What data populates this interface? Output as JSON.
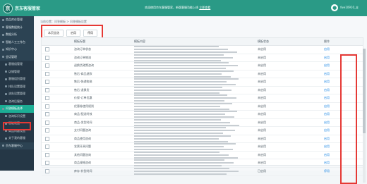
{
  "app": {
    "title": "京东客服管家",
    "notice": "欢迎使用京东客服管家，新版客服功能上线",
    "notice_link": "立即查看",
    "user": "fwe10910_支"
  },
  "sidebar": {
    "items": [
      {
        "label": "商品库存管理",
        "type": "group"
      },
      {
        "label": "客服数据统计",
        "type": "group"
      },
      {
        "label": "数据分析",
        "type": "group"
      },
      {
        "label": "智能人工工作台",
        "type": "group"
      },
      {
        "label": "知识中心",
        "type": "group"
      },
      {
        "label": "会话管理",
        "type": "group"
      },
      {
        "label": "客服组管理",
        "type": "child"
      },
      {
        "label": "店铺管理",
        "type": "child"
      },
      {
        "label": "客服组别管理",
        "type": "child"
      },
      {
        "label": "排队设置管理",
        "type": "child"
      },
      {
        "label": "流失设置管理",
        "type": "child"
      },
      {
        "label": "咨询后服务",
        "type": "child"
      },
      {
        "label": "问答模板选择",
        "type": "active"
      },
      {
        "label": "咨询标识设置",
        "type": "child"
      },
      {
        "label": "智能设置",
        "type": "child"
      },
      {
        "label": "商品问题设置",
        "type": "child"
      },
      {
        "label": "关于我的客服",
        "type": "child"
      },
      {
        "label": "京东客服中心",
        "type": "group"
      }
    ]
  },
  "breadcrumb": "当前位置：问答模板 > 问答模板设置",
  "toolbar": {
    "select_all": "本页全选",
    "enable": "启用",
    "disable": "停用"
  },
  "table": {
    "headers": [
      "模板标题",
      "模板内容",
      "模板状态",
      "操作"
    ],
    "rows": [
      {
        "title": "咨询订单状态",
        "status": "未启用",
        "op": "启用"
      },
      {
        "title": "咨询订单物流",
        "status": "未启用",
        "op": "启用"
      },
      {
        "title": "退换货政策咨询",
        "status": "未启用",
        "op": "启用"
      },
      {
        "title": "售后-商品退款",
        "status": "未启用",
        "op": "启用"
      },
      {
        "title": "售后-快递物流",
        "status": "未启用",
        "op": "启用"
      },
      {
        "title": "售后-退换货",
        "status": "未启用",
        "op": "启用"
      },
      {
        "title": "价保-订单优惠",
        "status": "未启用",
        "op": "启用"
      },
      {
        "title": "优惠券使用规则",
        "status": "未启用",
        "op": "启用"
      },
      {
        "title": "商品-配送时效",
        "status": "未启用",
        "op": "启用"
      },
      {
        "title": "商品-发货时间",
        "status": "未启用",
        "op": "启用"
      },
      {
        "title": "支付问题咨询",
        "status": "未启用",
        "op": "启用"
      },
      {
        "title": "商品使用咨询",
        "status": "未启用",
        "op": "启用"
      },
      {
        "title": "发票开具问题",
        "status": "未启用",
        "op": "启用"
      },
      {
        "title": "其他问题咨询",
        "status": "未启用",
        "op": "启用"
      },
      {
        "title": "商品规格咨询",
        "status": "未启用",
        "op": "启用"
      },
      {
        "title": "库存-补货时间",
        "status": "已启用",
        "op": "停用"
      }
    ]
  }
}
